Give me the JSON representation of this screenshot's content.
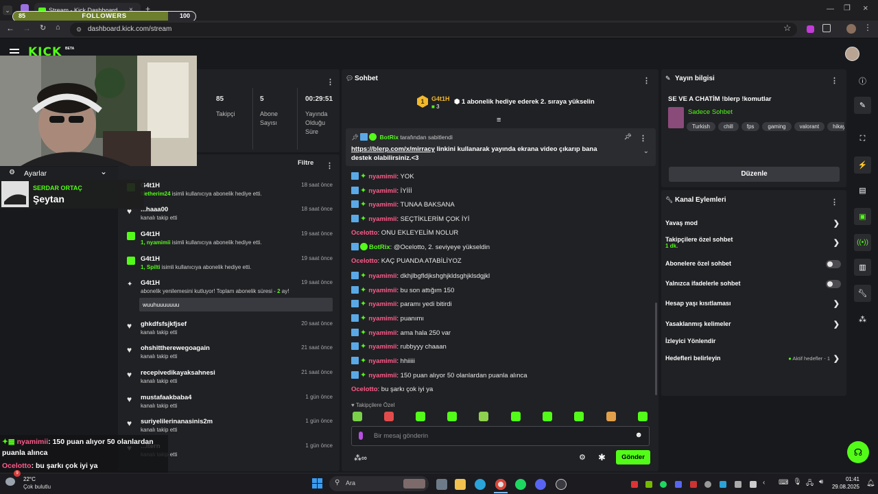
{
  "browser": {
    "tab_title": "Stream - Kick Dashboard",
    "url": "dashboard.kick.com/stream"
  },
  "followers_goal": {
    "current": "85",
    "label": "FOLLOWERS",
    "target": "100",
    "progress": 0.85
  },
  "kick": {
    "logo": "KICK",
    "beta": "BETA"
  },
  "stats": {
    "followers_value": "85",
    "followers_label": "Takipçi",
    "subs_value": "5",
    "subs_label1": "Abone",
    "subs_label2": "Sayısı",
    "uptime_value": "00:29:51",
    "uptime_label1": "Yayında",
    "uptime_label2": "Olduğu",
    "uptime_label3": "Süre"
  },
  "overlay": {
    "settings_label": "Ayarlar",
    "now_playing_artist": "SERDAR ORTAÇ",
    "now_playing_song": "Şeytan",
    "chat1_user": "nyamimii",
    "chat1_text": ": 150 puan alıyor 50 olanlardan",
    "chat1_text2": "puanla alınca",
    "chat2_user": "Ocelotto",
    "chat2_text": ": bu şarkı çok iyi ya"
  },
  "activity": {
    "filter_label": "Filtre",
    "items": [
      {
        "name": "G4t1H",
        "user": "Netherim24",
        "desc": " isimli kullanıcıya abonelik hediye etti.",
        "time": "18 saat önce"
      },
      {
        "name": "...haaa00",
        "user": "",
        "desc": "kanalı takip etti",
        "time": "18 saat önce"
      },
      {
        "name": "G4t1H",
        "user": "1, nyamimii",
        "desc": " isimli kullanıcıya abonelik hediye etti.",
        "time": "19 saat önce"
      },
      {
        "name": "G4t1H",
        "user": "1, Spilti",
        "desc": " isimli kullanıcıya abonelik hediye etti.",
        "time": "19 saat önce"
      },
      {
        "name": "G4t1H",
        "user": "",
        "desc": "abonelik yenilemesini kutluyor! Toplam abonelik süresi - ",
        "desc_num": "2",
        "desc_tail": " ay!",
        "time": "19 saat önce",
        "message": "wuuhuuuuuuu"
      },
      {
        "name": "ghkdfsfsjkfjsef",
        "user": "",
        "desc": "kanalı takip etti",
        "time": "20 saat önce"
      },
      {
        "name": "ohshittherewegoagain",
        "user": "",
        "desc": "kanalı takip etti",
        "time": "21 saat önce"
      },
      {
        "name": "recepivedikayaksahnesi",
        "user": "",
        "desc": "kanalı takip etti",
        "time": "21 saat önce"
      },
      {
        "name": "mustafaakbaba4",
        "user": "",
        "desc": "kanalı takip etti",
        "time": "1 gün önce"
      },
      {
        "name": "suriyelilerinanasinis2m",
        "user": "",
        "desc": "kanalı takip etti",
        "time": "1 gün önce"
      },
      {
        "name": "...ltern",
        "user": "",
        "desc": "kanalı takip etti",
        "time": "1 gün önce"
      }
    ]
  },
  "chat": {
    "title": "Sohbet",
    "top_gifter": {
      "rank": "1",
      "name": "G4t1H",
      "count": "3",
      "text": "1 abonelik hediye ederek 2. sıraya yükselin"
    },
    "pinned": {
      "by": "BotRix",
      "by_suffix": "tarafından sabitlendi",
      "link": "https://blerp.com/x/mirracy",
      "text": " linkini kullanarak yayında ekrana video çıkarıp bana destek olabilirsiniz.<3"
    },
    "messages": [
      {
        "user": "nyamimii",
        "text": ": YOK",
        "kind": "sub"
      },
      {
        "user": "nyamimii",
        "text": ": İYİİİ",
        "kind": "sub"
      },
      {
        "user": "nyamimii",
        "text": ": TUNAA BAKSANA",
        "kind": "sub"
      },
      {
        "user": "nyamimii",
        "text": ": SEÇTİKLERİM ÇOK İYİ",
        "kind": "sub"
      },
      {
        "user": "Ocelotto",
        "text": ": ONU EKLEYELİM NOLUR",
        "kind": "plain"
      },
      {
        "user": "BotRix",
        "text": ": @Ocelotto, 2. seviyeye yükseldin",
        "kind": "bot"
      },
      {
        "user": "Ocelotto",
        "text": ": KAÇ PUANDA ATABİLİYOZ",
        "kind": "plain"
      },
      {
        "user": "nyamimii",
        "text": ": dkhjlbgfldjkshghjkldsghjklsdgjkl",
        "kind": "sub"
      },
      {
        "user": "nyamimii",
        "text": ": bu son attığım 150",
        "kind": "sub"
      },
      {
        "user": "nyamimii",
        "text": ": paramı yedi bitirdi",
        "kind": "sub"
      },
      {
        "user": "nyamimii",
        "text": ": puanımı",
        "kind": "sub"
      },
      {
        "user": "nyamimii",
        "text": ": ama hala 250 var",
        "kind": "sub"
      },
      {
        "user": "nyamimii",
        "text": ": rubbyyy chaaan",
        "kind": "sub"
      },
      {
        "user": "nyamimii",
        "text": ": hhiiiii",
        "kind": "sub"
      },
      {
        "user": "nyamimii",
        "text": ": 150 puan alıyor 50 olanlardan puanla alınca",
        "kind": "sub"
      },
      {
        "user": "Ocelotto",
        "text": ": bu şarkı çok iyi ya",
        "kind": "plain"
      }
    ],
    "followers_only_label": "Takipçilere Özel",
    "input_placeholder": "Bir mesaj gönderin",
    "send_label": "Gönder"
  },
  "stream_info": {
    "title": "Yayın bilgisi",
    "stream_title": "SE VE A CHATİM !blerp !komutlar",
    "category": "Sadece Sohbet",
    "tags": [
      "Turkish",
      "chill",
      "fps",
      "gaming",
      "valorant",
      "hikay"
    ],
    "edit_label": "Düzenle"
  },
  "channel_actions": {
    "title": "Kanal Eylemleri",
    "slow_mode": "Yavaş mod",
    "followers_chat": "Takipçilere özel sohbet",
    "followers_chat_value": "1 dk.",
    "subs_chat": "Abonelere özel sohbet",
    "emote_chat": "Yalnızca ifadelerle sohbet",
    "account_age": "Hesap yaşı kısıtlaması",
    "banned_words": "Yasaklanmış kelimeler",
    "raid": "İzleyici Yönlendir",
    "goals": "Hedefleri belirleyin",
    "goals_status": "Aktif hedefler - 1"
  },
  "taskbar": {
    "temp": "22°C",
    "weather": "Çok bulutlu",
    "search": "Ara",
    "time": "01:41",
    "date": "29.08.2025",
    "notif_count": "9"
  },
  "colors": {
    "accent": "#53fc18",
    "pink": "#ff5b8a",
    "panel": "#202124",
    "bg": "#18191c"
  }
}
